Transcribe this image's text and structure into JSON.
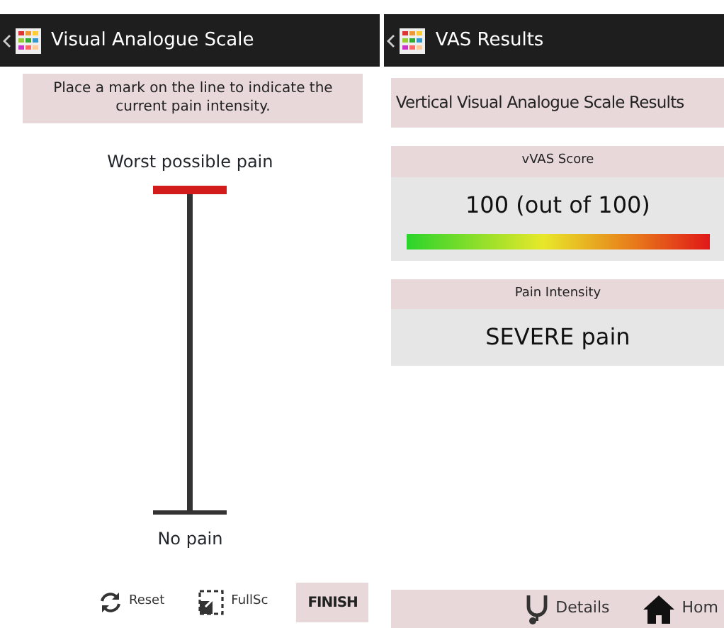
{
  "left_screen": {
    "title": "Visual Analogue Scale",
    "instruction": "Place a mark on the line to indicate the current pain intensity.",
    "scale": {
      "top_label": "Worst possible pain",
      "bottom_label": "No pain",
      "level": 1
    },
    "toolbar": [
      {
        "kind": "reset",
        "label": "Reset"
      },
      {
        "kind": "fullscreen",
        "label": "FullSc"
      },
      {
        "kind": "finish",
        "label": "FINISH"
      }
    ]
  },
  "right_screen": {
    "title": "VAS Results",
    "heading": "Vertical Visual Analogue Scale Results",
    "score": {
      "label": "vVAS Score",
      "value": "100 (out of 100)"
    },
    "intensity": {
      "label": "Pain Intensity",
      "value": "SEVERE pain"
    },
    "toolbar": [
      {
        "kind": "details",
        "label": "Details"
      },
      {
        "kind": "home",
        "label": "Hom"
      }
    ]
  }
}
